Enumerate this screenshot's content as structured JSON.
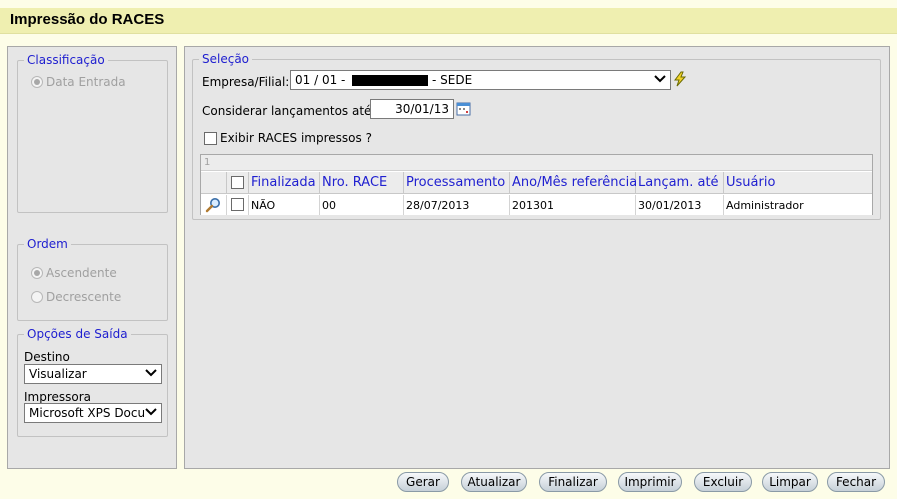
{
  "window": {
    "title": "Impressão do RACES"
  },
  "left": {
    "classificacao": {
      "legend": "Classificação",
      "options": [
        {
          "label": "Data Entrada",
          "selected": true
        }
      ]
    },
    "ordem": {
      "legend": "Ordem",
      "options": [
        {
          "label": "Ascendente",
          "selected": true
        },
        {
          "label": "Decrescente",
          "selected": false
        }
      ]
    },
    "saida": {
      "legend": "Opções de Saída",
      "destino_label": "Destino",
      "destino_value": "Visualizar",
      "impressora_label": "Impressora",
      "impressora_value": "Microsoft XPS Docu"
    }
  },
  "selecao": {
    "legend": "Seleção",
    "empresa_label": "Empresa/Filial:",
    "empresa_prefix": "01 / 01 -",
    "empresa_suffix": "- SEDE",
    "considerar_label": "Considerar lançamentos até:",
    "considerar_value": "30/01/13",
    "exibir_label": "Exibir RACES impressos ?",
    "exibir_checked": false
  },
  "grid": {
    "page_number": "1",
    "columns": [
      "Finalizada",
      "Nro. RACE",
      "Processamento",
      "Ano/Mês referência",
      "Lançam. até",
      "Usuário"
    ],
    "rows": [
      {
        "finalizada": "NÃO",
        "nro": "00",
        "processamento": "28/07/2013",
        "ano_mes": "201301",
        "lancam": "30/01/2013",
        "usuario": "Administrador"
      }
    ]
  },
  "buttons": {
    "gerar": "Gerar",
    "atualizar": "Atualizar",
    "finalizar": "Finalizar",
    "imprimir": "Imprimir",
    "excluir": "Excluir",
    "limpar": "Limpar",
    "fechar": "Fechar"
  },
  "colors": {
    "accent": "#2020d0",
    "title_bar": "#efefb0",
    "panel": "#e6e6e6"
  }
}
